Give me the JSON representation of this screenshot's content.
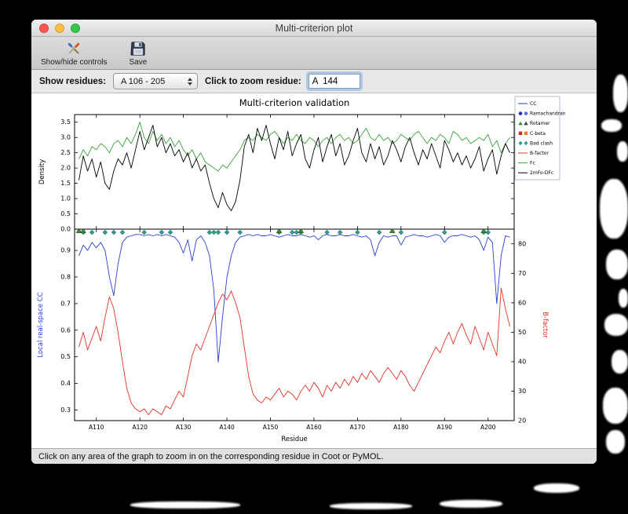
{
  "window": {
    "title": "Multi-criterion plot",
    "status": "Click on any area of the graph to zoom in on the corresponding residue in Coot or PyMOL."
  },
  "toolbar": {
    "show_hide_label": "Show/hide controls",
    "save_label": "Save"
  },
  "controls": {
    "show_residues_label": "Show residues:",
    "residue_range": "A 106 - 205",
    "zoom_label": "Click to zoom residue:",
    "zoom_value": "A  144"
  },
  "legend": {
    "entries": [
      {
        "label": "CC",
        "type": "line",
        "color": "#2a3fd0"
      },
      {
        "label": "Ramachandran",
        "type": "markers",
        "shape": "circle",
        "colors": [
          "#2233bb",
          "#5577dd"
        ]
      },
      {
        "label": "Rotamer",
        "type": "markers",
        "shape": "triangle",
        "colors": [
          "#3c8a3c",
          "#2f4f2f"
        ]
      },
      {
        "label": "C-beta",
        "type": "markers",
        "shape": "square",
        "colors": [
          "#cc2a2a",
          "#e08030"
        ]
      },
      {
        "label": "Bad clash",
        "type": "markers",
        "shape": "diamond",
        "colors": [
          "#2f9e8f",
          "#2f9e8f"
        ]
      },
      {
        "label": "B-factor",
        "type": "line",
        "color": "#e03228"
      },
      {
        "label": "Fc",
        "type": "line",
        "color": "#3da03d"
      },
      {
        "label": "2mFo-DFc",
        "type": "line",
        "color": "#000000"
      }
    ]
  },
  "chart_data": [
    {
      "type": "line",
      "title": "Multi-criterion validation",
      "ylabel": "Density",
      "ylim": [
        0.0,
        3.75
      ],
      "yticks": [
        0.0,
        0.5,
        1.0,
        1.5,
        2.0,
        2.5,
        3.0,
        3.5
      ],
      "x_start": 106,
      "series": [
        {
          "name": "Fc",
          "color": "#3da03d",
          "values": [
            2.3,
            2.6,
            2.4,
            2.7,
            2.6,
            2.8,
            2.7,
            2.5,
            2.8,
            2.9,
            2.7,
            3.0,
            2.8,
            3.1,
            3.5,
            3.0,
            2.8,
            3.2,
            2.9,
            3.1,
            2.8,
            3.0,
            2.7,
            2.9,
            2.6,
            2.4,
            2.6,
            2.3,
            2.5,
            2.2,
            2.1,
            2.0,
            1.9,
            2.1,
            2.0,
            2.2,
            2.4,
            2.6,
            2.9,
            3.0,
            2.9,
            3.1,
            3.0,
            2.9,
            3.1,
            3.2,
            3.0,
            2.8,
            3.0,
            2.9,
            3.1,
            2.9,
            2.8,
            3.0,
            2.9,
            2.7,
            2.9,
            3.0,
            2.8,
            3.0,
            3.1,
            2.9,
            3.0,
            2.8,
            2.9,
            3.1,
            3.3,
            3.0,
            2.9,
            3.1,
            2.9,
            3.0,
            2.8,
            2.9,
            3.1,
            3.0,
            2.9,
            3.1,
            3.2,
            3.0,
            2.8,
            3.0,
            2.9,
            3.1,
            3.0,
            2.8,
            3.2,
            3.1,
            2.9,
            3.0,
            2.8,
            2.9,
            3.0,
            2.9,
            3.1,
            2.7,
            2.9,
            2.5,
            2.8,
            3.0
          ]
        },
        {
          "name": "2mFo-DFc",
          "color": "#000000",
          "values": [
            1.6,
            2.4,
            1.9,
            2.3,
            1.7,
            2.2,
            1.5,
            1.3,
            1.9,
            2.3,
            2.1,
            2.5,
            2.0,
            2.6,
            3.2,
            2.6,
            3.0,
            3.4,
            2.7,
            3.0,
            2.5,
            2.8,
            2.4,
            2.6,
            2.2,
            2.5,
            2.0,
            2.3,
            1.9,
            2.1,
            1.5,
            1.0,
            0.7,
            1.2,
            0.8,
            0.6,
            0.9,
            1.6,
            2.7,
            3.1,
            2.5,
            3.3,
            2.9,
            3.4,
            2.8,
            2.3,
            3.0,
            2.6,
            3.2,
            2.4,
            2.8,
            3.1,
            2.3,
            2.0,
            2.6,
            3.0,
            2.2,
            2.7,
            3.1,
            2.4,
            2.8,
            2.1,
            2.4,
            2.9,
            3.3,
            2.5,
            2.2,
            2.8,
            2.3,
            2.7,
            2.1,
            2.4,
            2.9,
            2.6,
            2.2,
            2.7,
            3.0,
            2.5,
            2.1,
            2.6,
            2.3,
            2.8,
            2.4,
            2.0,
            2.9,
            2.6,
            2.2,
            2.5,
            2.1,
            2.4,
            2.0,
            2.3,
            2.7,
            1.9,
            2.3,
            2.6,
            1.8,
            2.4,
            2.8,
            2.5
          ]
        }
      ]
    },
    {
      "type": "line",
      "xlabel": "Residue",
      "xlim": [
        105,
        206
      ],
      "x_start": 106,
      "xticks": [
        110,
        120,
        130,
        140,
        150,
        160,
        170,
        180,
        190,
        200
      ],
      "xtick_labels": [
        "A110",
        "A120",
        "A130",
        "A140",
        "A150",
        "A160",
        "A170",
        "A180",
        "A190",
        "A200"
      ],
      "left_ylabel": "Local real-space CC",
      "left_color": "#2a3fd0",
      "left_ylim": [
        0.26,
        0.98
      ],
      "left_yticks": [
        0.3,
        0.4,
        0.5,
        0.6,
        0.7,
        0.8,
        0.9
      ],
      "right_ylabel": "B-factor",
      "right_color": "#e03228",
      "right_ylim": [
        20,
        85
      ],
      "right_yticks": [
        20,
        30,
        40,
        50,
        60,
        70,
        80
      ],
      "series": [
        {
          "name": "CC",
          "axis": "left",
          "color": "#2a3fd0",
          "values": [
            0.88,
            0.92,
            0.9,
            0.93,
            0.91,
            0.93,
            0.9,
            0.8,
            0.73,
            0.85,
            0.93,
            0.95,
            0.955,
            0.96,
            0.96,
            0.955,
            0.96,
            0.955,
            0.96,
            0.955,
            0.96,
            0.955,
            0.95,
            0.93,
            0.89,
            0.94,
            0.86,
            0.94,
            0.955,
            0.93,
            0.88,
            0.75,
            0.48,
            0.65,
            0.8,
            0.88,
            0.93,
            0.95,
            0.955,
            0.96,
            0.955,
            0.96,
            0.955,
            0.955,
            0.96,
            0.955,
            0.95,
            0.955,
            0.96,
            0.955,
            0.955,
            0.96,
            0.955,
            0.95,
            0.955,
            0.94,
            0.955,
            0.96,
            0.955,
            0.955,
            0.96,
            0.955,
            0.955,
            0.96,
            0.955,
            0.95,
            0.955,
            0.94,
            0.88,
            0.93,
            0.955,
            0.95,
            0.955,
            0.955,
            0.92,
            0.95,
            0.955,
            0.96,
            0.955,
            0.955,
            0.95,
            0.955,
            0.96,
            0.955,
            0.93,
            0.95,
            0.955,
            0.955,
            0.96,
            0.955,
            0.95,
            0.955,
            0.94,
            0.9,
            0.95,
            0.93,
            0.7,
            0.88,
            0.955,
            0.95
          ]
        },
        {
          "name": "B-factor",
          "axis": "right",
          "color": "#e03228",
          "values": [
            45,
            50,
            44,
            48,
            52,
            47,
            55,
            62,
            58,
            50,
            40,
            31,
            26,
            24,
            23,
            24,
            22,
            24,
            23,
            22,
            25,
            24,
            27,
            30,
            28,
            35,
            42,
            46,
            44,
            48,
            52,
            56,
            60,
            63,
            61,
            64,
            60,
            55,
            45,
            35,
            29,
            27,
            26,
            28,
            27,
            29,
            31,
            28,
            30,
            29,
            27,
            30,
            32,
            30,
            33,
            31,
            28,
            32,
            30,
            33,
            31,
            34,
            32,
            35,
            33,
            36,
            34,
            37,
            35,
            33,
            36,
            38,
            36,
            34,
            37,
            35,
            32,
            30,
            33,
            36,
            39,
            42,
            45,
            43,
            47,
            50,
            46,
            50,
            53,
            49,
            46,
            52,
            48,
            44,
            50,
            46,
            42,
            65,
            58,
            52
          ]
        }
      ],
      "markers": {
        "bad_clash": {
          "label": "Bad clash",
          "color": "#2f9e8f",
          "y": 0.968,
          "residues": [
            107,
            109,
            112,
            114,
            116,
            121,
            125,
            127,
            136,
            137,
            138,
            140,
            143,
            152,
            155,
            156,
            157,
            163,
            166,
            170,
            175,
            180,
            190,
            199,
            200
          ]
        },
        "rotamer": {
          "label": "Rotamer",
          "color": "#3c8a3c",
          "y": 0.974,
          "residues": [
            106,
            107,
            152,
            157,
            178,
            199
          ]
        }
      }
    }
  ]
}
